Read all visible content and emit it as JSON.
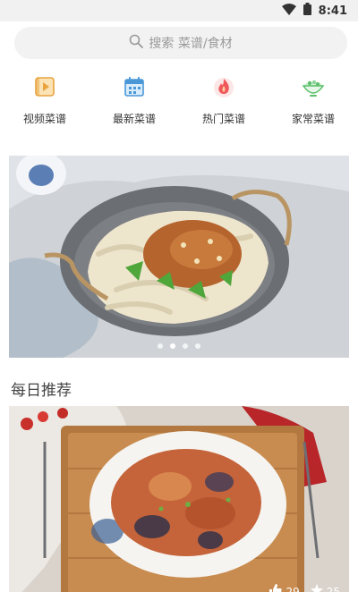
{
  "status": {
    "time": "8:41"
  },
  "search": {
    "placeholder": "搜索  菜谱/食材"
  },
  "categories": [
    {
      "label": "视频菜谱",
      "icon": "video-recipe-icon"
    },
    {
      "label": "最新菜谱",
      "icon": "calendar-icon"
    },
    {
      "label": "热门菜谱",
      "icon": "flame-icon"
    },
    {
      "label": "家常菜谱",
      "icon": "bowl-icon"
    }
  ],
  "banner": {
    "slides": 4,
    "active": 1
  },
  "section": {
    "title": "每日推荐"
  },
  "featured": {
    "likes": "29",
    "stars": "25"
  },
  "colors": {
    "accent": "#e8a33c",
    "search_bg": "#f2f2f2"
  }
}
